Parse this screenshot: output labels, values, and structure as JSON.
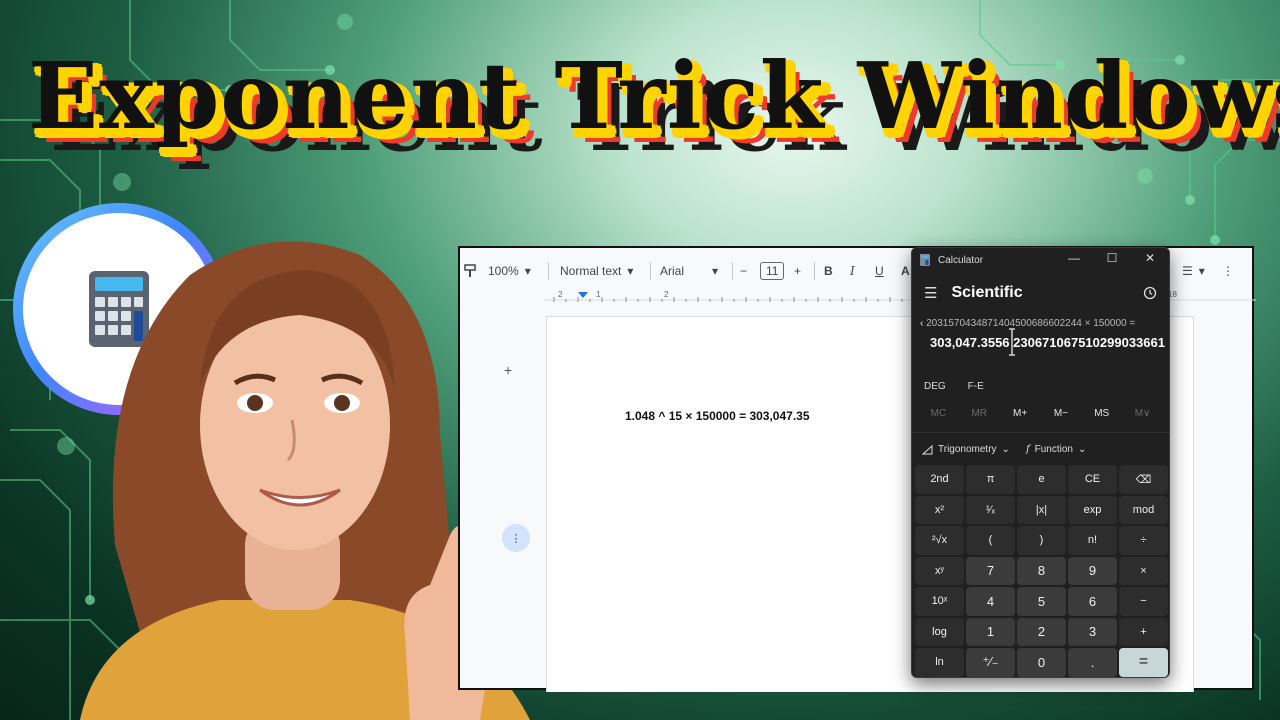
{
  "title": "Exponent Trick Windows",
  "docs": {
    "zoom": "100%",
    "style": "Normal text",
    "font": "Arial",
    "size": "11",
    "content_line": "1.048 ^ 15 × 150000 = 303,047.35",
    "ruler_marks": [
      "2",
      "1",
      "1",
      "2",
      "18"
    ]
  },
  "calculator": {
    "window_title": "Calculator",
    "mode": "Scientific",
    "expression": "2031570434871404500686602244 × 150000 =",
    "result": "303,047.3556 230671067510299033661",
    "angle_mode": "DEG",
    "fe_label": "F-E",
    "memory": [
      "MC",
      "MR",
      "M+",
      "M−",
      "MS",
      "M∨"
    ],
    "function_menus": [
      "Trigonometry",
      "Function"
    ],
    "keys": [
      "2nd",
      "π",
      "e",
      "CE",
      "⌫",
      "x²",
      "¹⁄ₓ",
      "|x|",
      "exp",
      "mod",
      "²√x",
      "(",
      ")",
      "n!",
      "÷",
      "xʸ",
      "7",
      "8",
      "9",
      "×",
      "10ˣ",
      "4",
      "5",
      "6",
      "−",
      "log",
      "1",
      "2",
      "3",
      "+",
      "ln",
      "⁺⁄₋",
      "0",
      ".",
      "="
    ]
  },
  "colors": {
    "accent_yellow": "#ffd400",
    "accent_red": "#ee3a2a",
    "calc_bg": "#202020",
    "equals_key": "#c7d6d9"
  }
}
